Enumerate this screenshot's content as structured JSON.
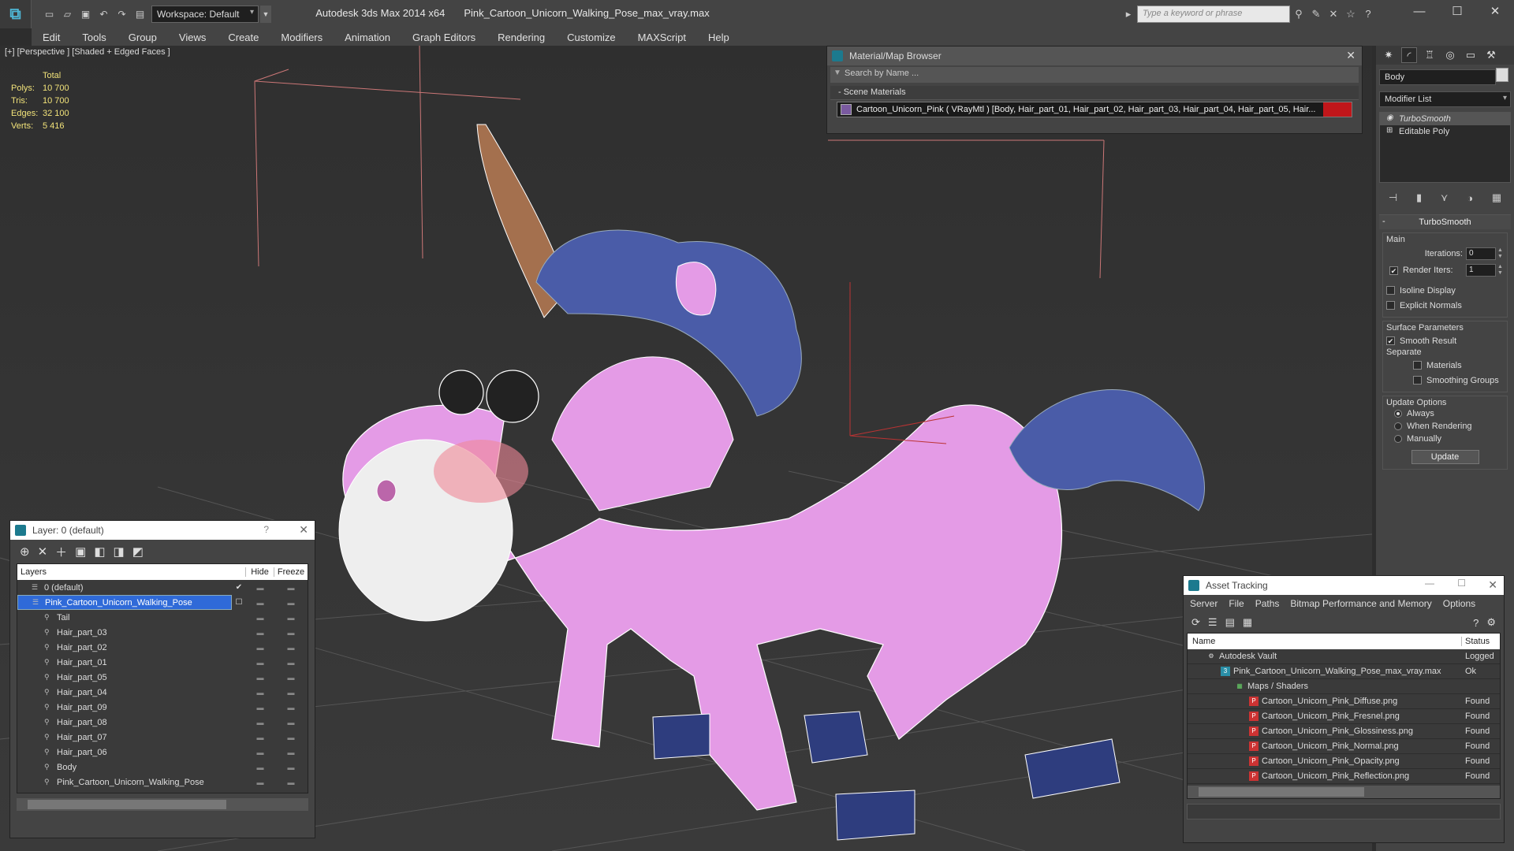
{
  "titlebar": {
    "workspace_label": "Workspace: Default",
    "app_name": "Autodesk 3ds Max  2014 x64",
    "file_name": "Pink_Cartoon_Unicorn_Walking_Pose_max_vray.max",
    "search_placeholder": "Type a keyword or phrase"
  },
  "menu": [
    "Edit",
    "Tools",
    "Group",
    "Views",
    "Create",
    "Modifiers",
    "Animation",
    "Graph Editors",
    "Rendering",
    "Customize",
    "MAXScript",
    "Help"
  ],
  "viewport": {
    "label": "[+] [Perspective ] [Shaded + Edged Faces ]",
    "stats": {
      "header": "Total",
      "rows": [
        {
          "k": "Polys:",
          "v": "10 700"
        },
        {
          "k": "Tris:",
          "v": "10 700"
        },
        {
          "k": "Edges:",
          "v": "32 100"
        },
        {
          "k": "Verts:",
          "v": "5 416"
        }
      ]
    }
  },
  "material_browser": {
    "title": "Material/Map Browser",
    "search": "Search by Name ...",
    "section": "- Scene Materials",
    "item": "Cartoon_Unicorn_Pink  ( VRayMtl )  [Body, Hair_part_01, Hair_part_02, Hair_part_03, Hair_part_04, Hair_part_05, Hair..."
  },
  "layer_panel": {
    "title": "Layer: 0 (default)",
    "help": "?",
    "close": "✕",
    "col_layers": "Layers",
    "col_hide": "Hide",
    "col_freeze": "Freeze",
    "rows": [
      {
        "name": "0 (default)",
        "indent": 1,
        "check": "✔"
      },
      {
        "name": "Pink_Cartoon_Unicorn_Walking_Pose",
        "indent": 1,
        "selected": true,
        "check": "☐"
      },
      {
        "name": "Tail",
        "indent": 2
      },
      {
        "name": "Hair_part_03",
        "indent": 2
      },
      {
        "name": "Hair_part_02",
        "indent": 2
      },
      {
        "name": "Hair_part_01",
        "indent": 2
      },
      {
        "name": "Hair_part_05",
        "indent": 2
      },
      {
        "name": "Hair_part_04",
        "indent": 2
      },
      {
        "name": "Hair_part_09",
        "indent": 2
      },
      {
        "name": "Hair_part_08",
        "indent": 2
      },
      {
        "name": "Hair_part_07",
        "indent": 2
      },
      {
        "name": "Hair_part_06",
        "indent": 2
      },
      {
        "name": "Body",
        "indent": 2
      },
      {
        "name": "Pink_Cartoon_Unicorn_Walking_Pose",
        "indent": 2
      }
    ]
  },
  "command_panel": {
    "object_name": "Body",
    "modifier_list": "Modifier List",
    "stack": [
      "TurboSmooth",
      "Editable Poly"
    ],
    "rollout_title": "TurboSmooth",
    "main_label": "Main",
    "iterations_label": "Iterations:",
    "iterations_value": "0",
    "render_iters_label": "Render Iters:",
    "render_iters_value": "1",
    "isoline": "Isoline Display",
    "explicit": "Explicit Normals",
    "surface_label": "Surface Parameters",
    "smooth_result": "Smooth Result",
    "separate_label": "Separate",
    "materials": "Materials",
    "smoothing_groups": "Smoothing Groups",
    "update_options": "Update Options",
    "always": "Always",
    "when_rendering": "When Rendering",
    "manually": "Manually",
    "update_btn": "Update"
  },
  "asset_tracking": {
    "title": "Asset Tracking",
    "menu": [
      "Server",
      "File",
      "Paths",
      "Bitmap Performance and Memory",
      "Options"
    ],
    "col_name": "Name",
    "col_status": "Status",
    "rows": [
      {
        "name": "Autodesk Vault",
        "status": "Logged",
        "indent": 1,
        "icon": "vault"
      },
      {
        "name": "Pink_Cartoon_Unicorn_Walking_Pose_max_vray.max",
        "status": "Ok",
        "indent": 2,
        "icon": "max"
      },
      {
        "name": "Maps / Shaders",
        "status": "",
        "indent": 3,
        "icon": "maps"
      },
      {
        "name": "Cartoon_Unicorn_Pink_Diffuse.png",
        "status": "Found",
        "indent": 4,
        "icon": "png"
      },
      {
        "name": "Cartoon_Unicorn_Pink_Fresnel.png",
        "status": "Found",
        "indent": 4,
        "icon": "png"
      },
      {
        "name": "Cartoon_Unicorn_Pink_Glossiness.png",
        "status": "Found",
        "indent": 4,
        "icon": "png"
      },
      {
        "name": "Cartoon_Unicorn_Pink_Normal.png",
        "status": "Found",
        "indent": 4,
        "icon": "png"
      },
      {
        "name": "Cartoon_Unicorn_Pink_Opacity.png",
        "status": "Found",
        "indent": 4,
        "icon": "png"
      },
      {
        "name": "Cartoon_Unicorn_Pink_Reflection.png",
        "status": "Found",
        "indent": 4,
        "icon": "png"
      }
    ]
  }
}
